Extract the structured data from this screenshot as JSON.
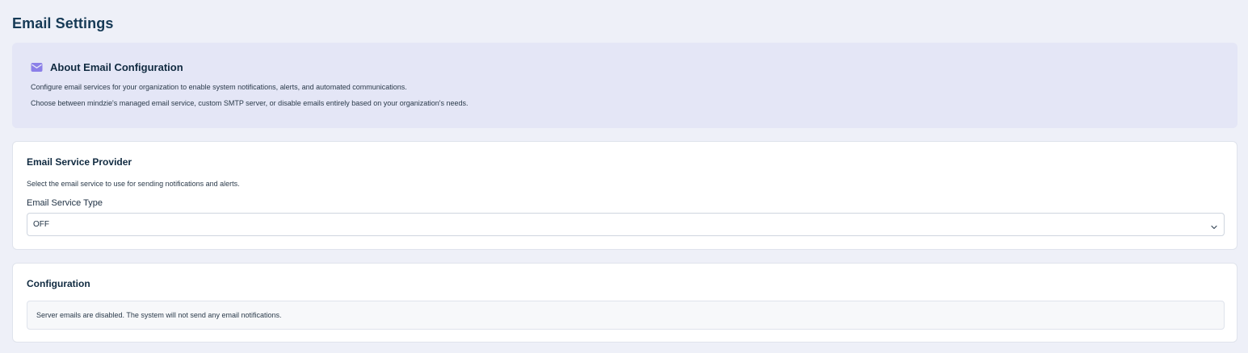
{
  "page": {
    "title": "Email Settings"
  },
  "about": {
    "icon": "mail-icon",
    "title": "About Email Configuration",
    "line1": "Configure email services for your organization to enable system notifications, alerts, and automated communications.",
    "line2": "Choose between mindzie's managed email service, custom SMTP server, or disable emails entirely based on your organization's needs."
  },
  "provider": {
    "title": "Email Service Provider",
    "description": "Select the email service to use for sending notifications and alerts.",
    "field_label": "Email Service Type",
    "selected_value": "OFF",
    "dropdown_icon": "chevron-down-icon"
  },
  "configuration": {
    "title": "Configuration",
    "notice": "Server emails are disabled. The system will not send any email notifications."
  },
  "colors": {
    "background": "#eef0f8",
    "about_background": "#e4e6f6",
    "icon_accent": "#8b7fe8",
    "heading": "#163a56"
  }
}
